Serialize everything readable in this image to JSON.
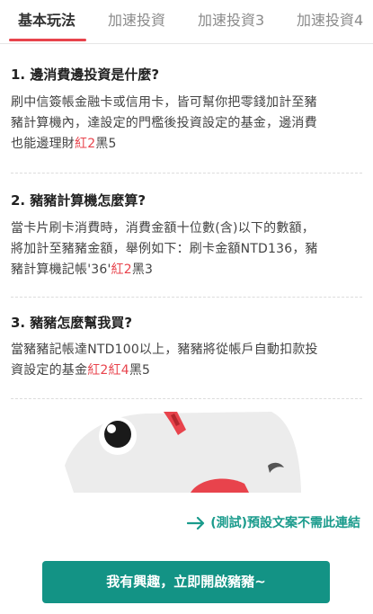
{
  "tabs": [
    {
      "label": "基本玩法"
    },
    {
      "label": "加速投資"
    },
    {
      "label": "加速投資3"
    },
    {
      "label": "加速投資4"
    }
  ],
  "faq": [
    {
      "question": "1. 邊消費邊投資是什麼?",
      "answer_lines": [
        [
          "刷中信簽帳金融卡或信用卡，皆可幫你把零錢加計至豬"
        ],
        [
          "豬計算機內，達設定的門檻後投資設定的基金，邊消費"
        ],
        [
          "也能邊理財",
          {
            "red": "紅2"
          },
          "黑5"
        ]
      ]
    },
    {
      "question": "2. 豬豬計算機怎麼算?",
      "answer_lines": [
        [
          "當卡片刷卡消費時，消費金額十位數(含)以下的數額，"
        ],
        [
          "將加計至豬豬金額，舉例如下：刷卡金額NTD136，豬"
        ],
        [
          "豬計算機記帳'36'",
          {
            "red": "紅2"
          },
          "黑3"
        ]
      ]
    },
    {
      "question": "3. 豬豬怎麼幫我買?",
      "answer_lines": [
        [
          "當豬豬記帳達NTD100以上，豬豬將從帳戶自動扣款投"
        ],
        [
          "資設定的基金",
          {
            "red": "紅2紅4"
          },
          "黑5"
        ]
      ]
    }
  ],
  "link": {
    "icon": "arrow-right-icon",
    "label": "(測試)預設文案不需此連結"
  },
  "cta": {
    "label": "我有興趣，立即開啟豬豬~"
  },
  "colors": {
    "accent_red": "#e8434c",
    "accent_teal": "#139385",
    "link_teal": "#1a9b8c"
  }
}
